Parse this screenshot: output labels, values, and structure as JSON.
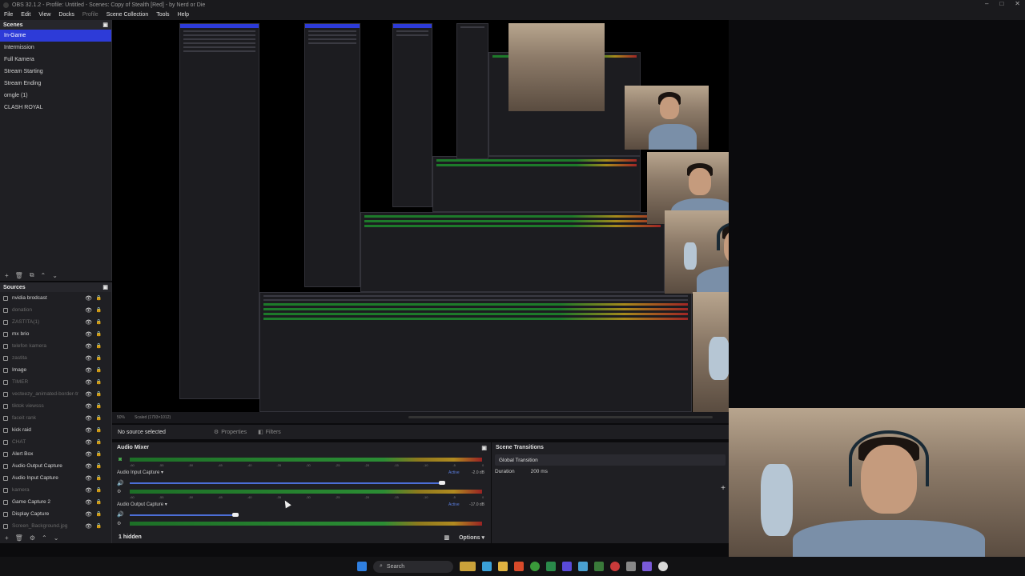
{
  "window": {
    "title": "OBS 32.1.2 - Profile: Untitled - Scenes: Copy of Stealth [Red] - by Nerd or Die",
    "controls": [
      "–",
      "□",
      "✕"
    ]
  },
  "menu": [
    "File",
    "Edit",
    "View",
    "Docks",
    "Profile",
    "Scene Collection",
    "Tools",
    "Help"
  ],
  "scenes": {
    "title": "Scenes",
    "items": [
      "In-Game",
      "Intermission",
      "Full Kamera",
      "Stream Starting",
      "Stream Ending",
      "omgle (1)",
      "CLASH ROYAL"
    ],
    "selected": 0
  },
  "sources": {
    "title": "Sources",
    "items": [
      {
        "label": "nvidia brodcast",
        "dim": false
      },
      {
        "label": "donation",
        "dim": true
      },
      {
        "label": "ZASTITA(1)",
        "dim": true
      },
      {
        "label": "mx brio",
        "dim": false
      },
      {
        "label": "telefon kamera",
        "dim": true
      },
      {
        "label": "zastita",
        "dim": true
      },
      {
        "label": "Image",
        "dim": false
      },
      {
        "label": "TIMER",
        "dim": true
      },
      {
        "label": "vecteezy_animated-border-tr",
        "dim": true
      },
      {
        "label": "tiktok viewsss",
        "dim": true
      },
      {
        "label": "faceit rank",
        "dim": true
      },
      {
        "label": "kick raid",
        "dim": false
      },
      {
        "label": "CHAT",
        "dim": true
      },
      {
        "label": "Alert Box",
        "dim": false
      },
      {
        "label": "Audio Output Capture",
        "dim": false
      },
      {
        "label": "Audio Input Capture",
        "dim": false
      },
      {
        "label": "kamera",
        "dim": true
      },
      {
        "label": "Game Capture 2",
        "dim": false
      },
      {
        "label": "Display Capture",
        "dim": false
      },
      {
        "label": "Screen_Background.jpg",
        "dim": true
      }
    ]
  },
  "scalebar": {
    "items": [
      "50%",
      "Scaled (1793×1012)"
    ]
  },
  "props": {
    "no_source": "No source selected",
    "properties": "Properties",
    "filters": "Filters"
  },
  "mixer": {
    "title": "Audio Mixer",
    "ticks": [
      "-60",
      "-55",
      "-50",
      "-45",
      "-40",
      "-35",
      "-30",
      "-25",
      "-20",
      "-15",
      "-10",
      "-5",
      "0"
    ],
    "channels": [
      {
        "label": "Audio Input Capture",
        "db": "-2.0 dB",
        "status": "Active"
      },
      {
        "label": "Audio Output Capture",
        "db": "-17.0 dB",
        "status": "Active"
      }
    ],
    "hidden": "1 hidden",
    "options": "Options"
  },
  "transitions": {
    "title": "Scene Transitions",
    "selected": "Global Transition",
    "duration_label": "Duration",
    "duration_value": "200 ms"
  },
  "taskbar": {
    "search": "Search"
  }
}
